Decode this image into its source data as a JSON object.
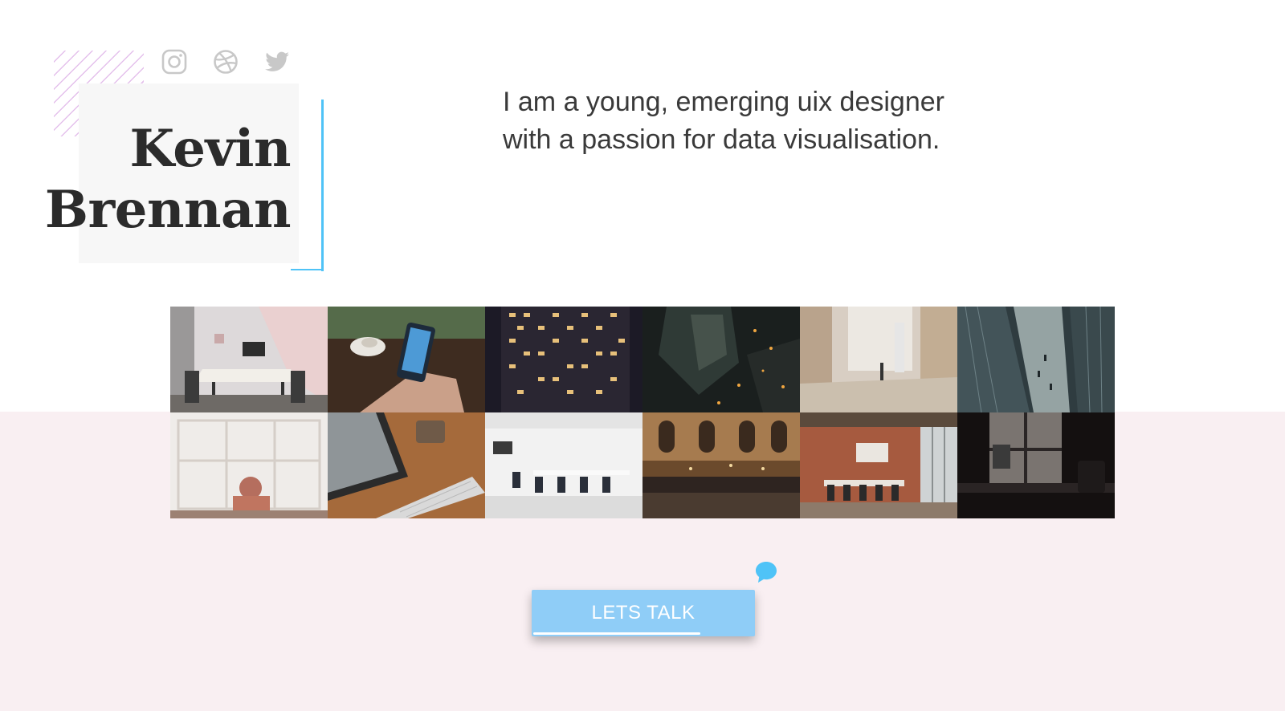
{
  "colors": {
    "accent": "#4fc3f7",
    "button": "#8fcdf7",
    "band": "#f9eff2",
    "stripes": "#ce8cdc"
  },
  "social_links": [
    {
      "name": "instagram-icon"
    },
    {
      "name": "dribbble-icon"
    },
    {
      "name": "twitter-icon"
    }
  ],
  "profile": {
    "first_name": "Kevin",
    "last_name": "Brennan"
  },
  "intro": {
    "text": "I am a young, emerging uix designer with a passion for data visualisation."
  },
  "gallery": {
    "photos": [
      {
        "description": "meeting-room"
      },
      {
        "description": "hand-holding-phone"
      },
      {
        "description": "building-windows-night"
      },
      {
        "description": "city-aerial-night"
      },
      {
        "description": "desk-with-computer"
      },
      {
        "description": "street-between-buildings"
      },
      {
        "description": "person-at-window"
      },
      {
        "description": "laptop-and-mug"
      },
      {
        "description": "white-conference-room"
      },
      {
        "description": "cafe-interior"
      },
      {
        "description": "brick-meeting-room"
      },
      {
        "description": "dark-office-desk"
      }
    ]
  },
  "cta": {
    "label": "LETS TALK",
    "progress": 0.76
  },
  "chat": {
    "icon": "chat-bubble-icon"
  }
}
